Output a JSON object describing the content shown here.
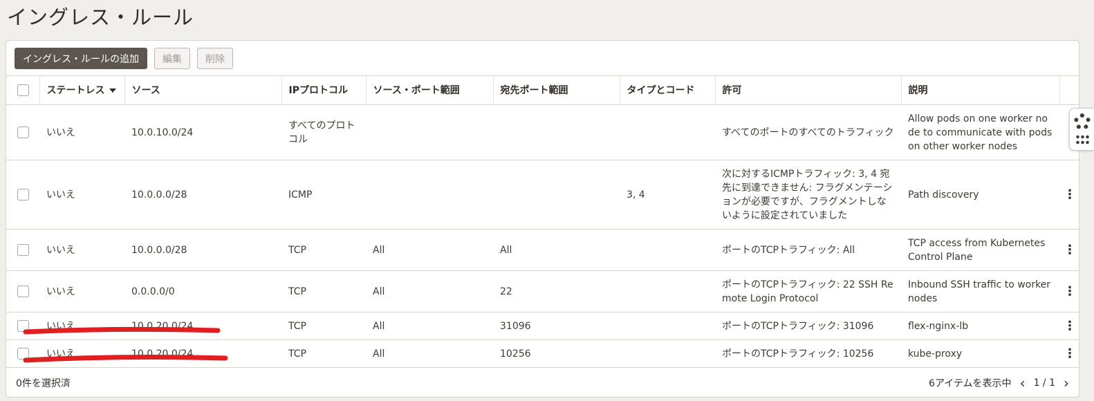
{
  "page": {
    "title": "イングレス・ルール"
  },
  "toolbar": {
    "add_label": "イングレス・ルールの追加",
    "edit_label": "編集",
    "delete_label": "削除"
  },
  "table": {
    "columns": [
      "ステートレス",
      "ソース",
      "IPプロトコル",
      "ソース・ポート範囲",
      "宛先ポート範囲",
      "タイプとコード",
      "許可",
      "説明"
    ],
    "rows": [
      {
        "stateless": "いいえ",
        "source": "10.0.10.0/24",
        "protocol": "すべてのプロトコル",
        "src_port": "",
        "dst_port": "",
        "type_code": "",
        "allows": "すべてのポートのすべてのトラフィック",
        "description": "Allow pods on one worker node to communicate with pods on other worker nodes"
      },
      {
        "stateless": "いいえ",
        "source": "10.0.0.0/28",
        "protocol": "ICMP",
        "src_port": "",
        "dst_port": "",
        "type_code": "3, 4",
        "allows": "次に対するICMPトラフィック: 3, 4 宛先に到達できません: フラグメンテーションが必要ですが、フラグメントしないように設定されていました",
        "description": "Path discovery"
      },
      {
        "stateless": "いいえ",
        "source": "10.0.0.0/28",
        "protocol": "TCP",
        "src_port": "All",
        "dst_port": "All",
        "type_code": "",
        "allows": "ポートのTCPトラフィック: All",
        "description": "TCP access from Kubernetes Control Plane"
      },
      {
        "stateless": "いいえ",
        "source": "0.0.0.0/0",
        "protocol": "TCP",
        "src_port": "All",
        "dst_port": "22",
        "type_code": "",
        "allows": "ポートのTCPトラフィック: 22 SSH Remote Login Protocol",
        "description": "Inbound SSH traffic to worker nodes"
      },
      {
        "stateless": "いいえ",
        "source": "10.0.20.0/24",
        "protocol": "TCP",
        "src_port": "All",
        "dst_port": "31096",
        "type_code": "",
        "allows": "ポートのTCPトラフィック: 31096",
        "description": "flex-nginx-lb"
      },
      {
        "stateless": "いいえ",
        "source": "10.0.20.0/24",
        "protocol": "TCP",
        "src_port": "All",
        "dst_port": "10256",
        "type_code": "",
        "allows": "ポートのTCPトラフィック: 10256",
        "description": "kube-proxy"
      }
    ]
  },
  "footer": {
    "selected": "0件を選択済",
    "showing": "6アイテムを表示中",
    "page": "1 / 1"
  },
  "colors": {
    "annotation_red": "#e02020",
    "primary_button": "#5d5650"
  },
  "icons": {
    "help": "lifebuoy-icon",
    "apps": "grid-icon",
    "row_actions": "kebab-icon"
  }
}
